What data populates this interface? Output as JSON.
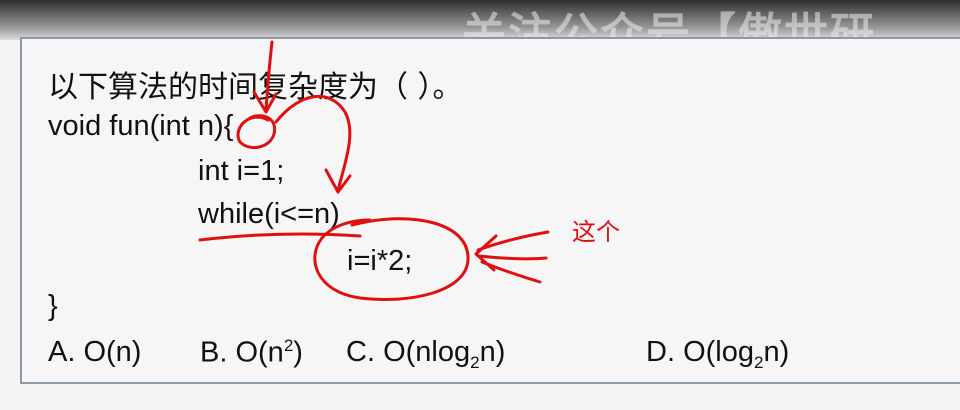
{
  "watermark": "关注公众号【傲世研",
  "question": "以下算法的时间复杂度为（        ）。",
  "code": {
    "line1": "void fun(int n){",
    "line2": "int i=1;",
    "line3": "while(i<=n)",
    "line4": "i=i*2;",
    "line5": "}"
  },
  "options": {
    "a": {
      "letter": "A.",
      "base": "O(n)"
    },
    "b": {
      "letter": "B.",
      "pre": "O(n",
      "sup": "2",
      "post": ")"
    },
    "c": {
      "letter": "C.",
      "pre": "O(nlog",
      "sub": "2",
      "post": "n)"
    },
    "d": {
      "letter": "D.",
      "pre": "O(log",
      "sub": "2",
      "post": "n)"
    }
  },
  "annotation": "这个",
  "colors": {
    "annotation": "#e01010",
    "ink": "#e01010"
  }
}
